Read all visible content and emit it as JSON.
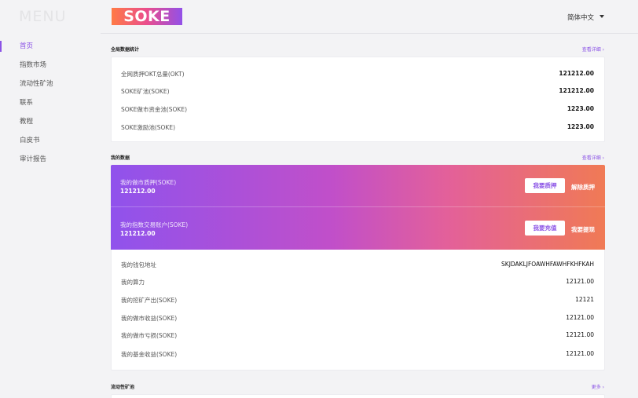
{
  "menu": {
    "title": "MENU",
    "items": [
      {
        "label": "首页"
      },
      {
        "label": "指数市场"
      },
      {
        "label": "流动性矿池"
      },
      {
        "label": "联系"
      },
      {
        "label": "教程"
      },
      {
        "label": "白皮书"
      },
      {
        "label": "审计报告"
      }
    ],
    "active_index": 0
  },
  "header": {
    "logo_text": "SOKE",
    "language": "简体中文"
  },
  "global_stats": {
    "title": "全局数据统计",
    "link": "查看详细 ›",
    "rows": [
      {
        "label": "全网质押OKT总量(OKT)",
        "value": "121212.00"
      },
      {
        "label": "SOKE矿池(SOKE)",
        "value": "121212.00"
      },
      {
        "label": "SOKE做市资金池(SOKE)",
        "value": "1223.00"
      },
      {
        "label": "SOKE激励池(SOKE)",
        "value": "1223.00"
      }
    ]
  },
  "my_data": {
    "title": "我的数据",
    "link": "查看详细 ›",
    "pledge": {
      "label": "我的做市质押(SOKE)",
      "value": "121212.00",
      "button": "我要质押",
      "link": "解除质押"
    },
    "index_account": {
      "label": "我的指数交易账户(SOKE)",
      "value": "121212.00",
      "button": "我要充值",
      "link": "我要提现"
    },
    "rows": [
      {
        "label": "我的钱包地址",
        "value": "SKJDAKLJFOAWHFAWHFKHFKAH"
      },
      {
        "label": "我的算力",
        "value": "12121.00"
      },
      {
        "label": "我的挖矿产出(SOKE)",
        "value": "12121"
      },
      {
        "label": "我的做市收益(SOKE)",
        "value": "12121.00"
      },
      {
        "label": "我的做市亏损(SOKE)",
        "value": "12121.00"
      },
      {
        "label": "我的基金收益(SOKE)",
        "value": "12121.00"
      }
    ]
  },
  "liquidity_pool": {
    "title": "流动性矿池",
    "link": "更多 ›"
  },
  "colors": {
    "accent": "#8b53e6",
    "gradient_start": "#9052ec",
    "gradient_end": "#f07a55"
  }
}
